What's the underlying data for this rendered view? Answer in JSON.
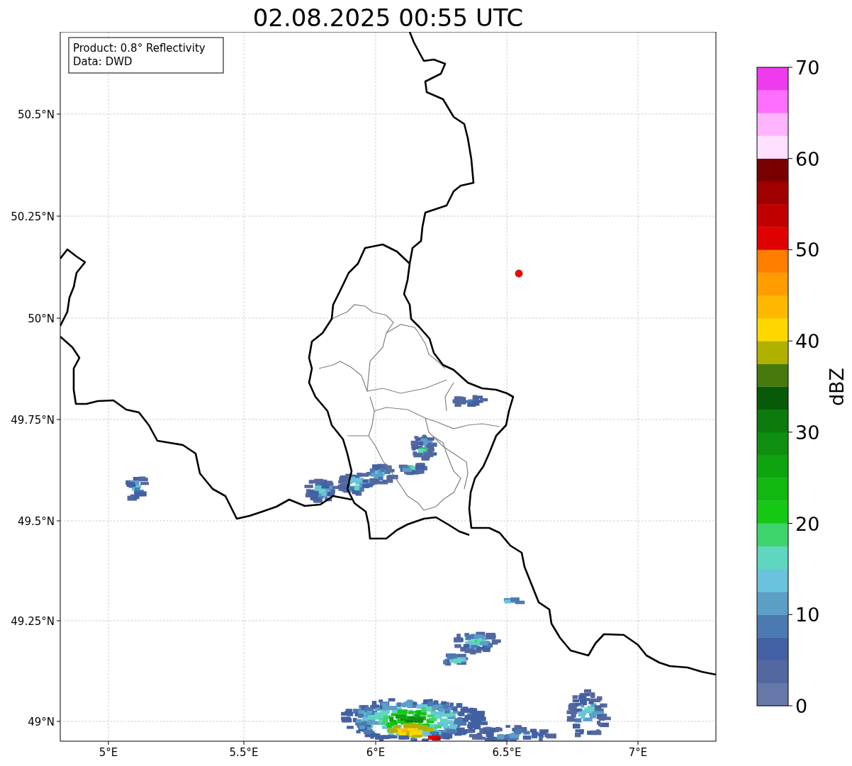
{
  "title": "02.08.2025 00:55 UTC",
  "info_box": [
    "Product: 0.8° Reflectivity",
    "Data: DWD"
  ],
  "y_ticks": [
    "50.5°N",
    "50.25°N",
    "50°N",
    "49.75°N",
    "49.5°N",
    "49.25°N",
    "49°N"
  ],
  "x_ticks": [
    "5°E",
    "5.5°E",
    "6°E",
    "6.5°E",
    "7°E"
  ],
  "colorbar": {
    "label": "dBZ",
    "ticks": [
      "70",
      "60",
      "50",
      "40",
      "30",
      "20",
      "10",
      "0"
    ],
    "bins": [
      {
        "color": "#6678a8"
      },
      {
        "color": "#5367a0"
      },
      {
        "color": "#4360a2"
      },
      {
        "color": "#4b7ab0"
      },
      {
        "color": "#5b9fc6"
      },
      {
        "color": "#69c3dc"
      },
      {
        "color": "#5fd6c0"
      },
      {
        "color": "#3ed46c"
      },
      {
        "color": "#14c814"
      },
      {
        "color": "#10b810"
      },
      {
        "color": "#10a310"
      },
      {
        "color": "#0f8f0f"
      },
      {
        "color": "#0c7a0c"
      },
      {
        "color": "#085a08"
      },
      {
        "color": "#467a0c"
      },
      {
        "color": "#b0b000"
      },
      {
        "color": "#ffd700"
      },
      {
        "color": "#ffb800"
      },
      {
        "color": "#ff9c00"
      },
      {
        "color": "#ff7e00"
      },
      {
        "color": "#e00000"
      },
      {
        "color": "#c00000"
      },
      {
        "color": "#a00000"
      },
      {
        "color": "#780000"
      },
      {
        "color": "#ffe0ff"
      },
      {
        "color": "#ffb4ff"
      },
      {
        "color": "#ff6eff"
      },
      {
        "color": "#ee3bee"
      }
    ]
  }
}
